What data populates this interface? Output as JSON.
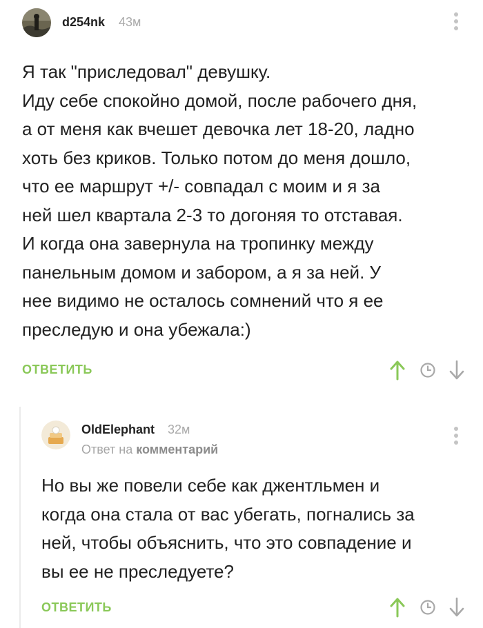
{
  "comments": [
    {
      "username": "d254nk",
      "time": "43м",
      "text": "Я так \"приследовал\" девушку.\nИду себе спокойно домой, после рабочего дня,\nа от меня как вчешет девочка лет 18-20, ладно\nхоть без криков. Только потом до меня дошло,\nчто ее маршрут +/- совпадал с моим и я за\nней шел квартала 2-3 то догоняя то отставая.\nИ когда она завернула на тропинку между\nпанельным домом и забором, а я за ней. У\nнее видимо не осталось сомнений что я ее\nпреследую и она убежала:)",
      "reply_label": "ОТВЕТИТЬ"
    },
    {
      "username": "OldElephant",
      "time": "32м",
      "reply_to_prefix": "Ответ на",
      "reply_to_link": "комментарий",
      "text": "Но вы же повели себе как джентльмен и\nкогда она стала от вас убегать, погнались за\nней, чтобы объяснить, что это совпадение и\nвы ее не преследуете?",
      "reply_label": "ОТВЕТИТЬ"
    }
  ],
  "colors": {
    "accent_green": "#8ac858",
    "icon_gray": "#a9a9a9",
    "time_gray": "#aaaaaa"
  }
}
